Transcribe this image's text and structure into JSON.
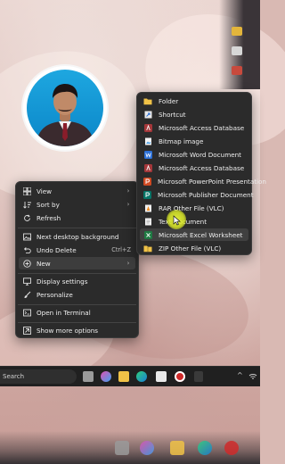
{
  "context_menu": {
    "items": [
      {
        "label": "View",
        "icon": "grid-icon",
        "has_submenu": true
      },
      {
        "label": "Sort by",
        "icon": "sort-icon",
        "has_submenu": true
      },
      {
        "label": "Refresh",
        "icon": "refresh-icon"
      },
      {
        "label": "Next desktop background",
        "icon": "picture-icon"
      },
      {
        "label": "Undo Delete",
        "icon": "undo-icon",
        "shortcut": "Ctrl+Z"
      },
      {
        "label": "New",
        "icon": "plus-circle-icon",
        "has_submenu": true
      },
      {
        "label": "Display settings",
        "icon": "monitor-icon"
      },
      {
        "label": "Personalize",
        "icon": "brush-icon"
      },
      {
        "label": "Open in Terminal",
        "icon": "terminal-icon"
      },
      {
        "label": "Show more options",
        "icon": "expand-icon"
      }
    ],
    "arrow_glyph": "›"
  },
  "new_submenu": {
    "items": [
      {
        "label": "Folder",
        "icon": "folder-icon"
      },
      {
        "label": "Shortcut",
        "icon": "shortcut-icon"
      },
      {
        "label": "Microsoft Access Database",
        "icon": "access-icon"
      },
      {
        "label": "Bitmap image",
        "icon": "bitmap-icon"
      },
      {
        "label": "Microsoft Word Document",
        "icon": "word-icon"
      },
      {
        "label": "Microsoft Access Database",
        "icon": "access-icon"
      },
      {
        "label": "Microsoft PowerPoint Presentation",
        "icon": "powerpoint-icon"
      },
      {
        "label": "Microsoft Publisher Document",
        "icon": "publisher-icon"
      },
      {
        "label": "RAR Other File (VLC)",
        "icon": "vlc-icon"
      },
      {
        "label": "Text Document",
        "icon": "text-doc-icon"
      },
      {
        "label": "Microsoft Excel Worksheet",
        "icon": "excel-icon"
      },
      {
        "label": "ZIP Other File (VLC)",
        "icon": "zip-icon"
      }
    ]
  },
  "taskbar": {
    "search_label": "Search",
    "tray_chevron": "^"
  },
  "colors": {
    "menu_bg": "#2b2b2b",
    "highlight": "#3d3d3d",
    "folder": "#f0c247",
    "word": "#2b6fd6",
    "access": "#a4373a",
    "powerpoint": "#d04a23",
    "publisher": "#077568",
    "excel": "#1f7a43",
    "cursor_highlight": "#e6f03c"
  }
}
